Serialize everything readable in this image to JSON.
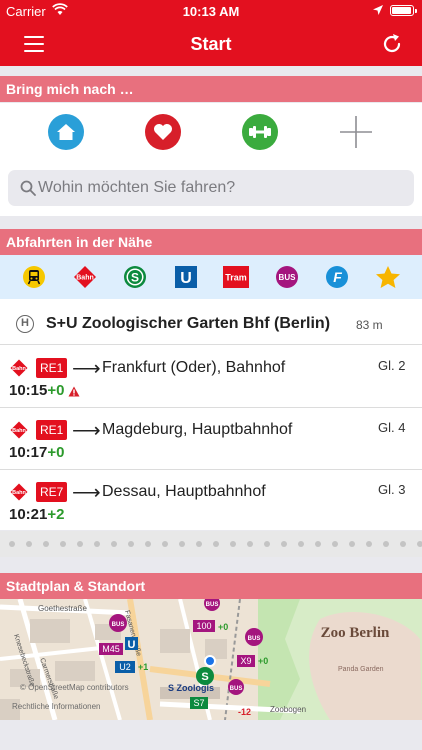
{
  "status_bar": {
    "carrier": "Carrier",
    "time": "10:13 AM",
    "battery_level": 0.95
  },
  "nav": {
    "title": "Start"
  },
  "bring": {
    "header": "Bring mich nach …",
    "shortcuts": [
      {
        "icon": "home-icon",
        "color": "#2a9fd8"
      },
      {
        "icon": "heart-icon",
        "color": "#d71f2a"
      },
      {
        "icon": "dumbbell-icon",
        "color": "#3bab3e"
      },
      {
        "icon": "plus-icon",
        "color": "#8e8e93"
      }
    ]
  },
  "search": {
    "placeholder": "Wohin möchten Sie fahren?"
  },
  "nearby": {
    "header": "Abfahrten in der Nähe",
    "filters": [
      "regional-train-icon",
      "bahn-icon",
      "s-bahn-icon",
      "u-bahn-icon",
      "tram-icon",
      "bus-icon",
      "ferry-icon",
      "star-icon"
    ],
    "filter_labels": {
      "bahn": "Bahn",
      "s": "S",
      "u": "U",
      "tram": "Tram",
      "bus": "BUS",
      "ferry": "F"
    }
  },
  "station": {
    "badge": "H",
    "name": "S+U Zoologischer Garten Bhf (Berlin)",
    "distance": "83 m"
  },
  "departures": [
    {
      "line": "RE1",
      "destination": "Frankfurt (Oder), Bahnhof",
      "track": "Gl. 2",
      "time": "10:15",
      "delay": "+0",
      "warning": true
    },
    {
      "line": "RE1",
      "destination": "Magdeburg, Hauptbahnhof",
      "track": "Gl. 4",
      "time": "10:17",
      "delay": "+0",
      "warning": false
    },
    {
      "line": "RE7",
      "destination": "Dessau, Hauptbahnhof",
      "track": "Gl. 3",
      "time": "10:21",
      "delay": "+2",
      "warning": false
    }
  ],
  "departure_arrow": "⟶",
  "bahn_logo_text": "Bahn",
  "map": {
    "header": "Stadtplan & Standort",
    "attribution": "© OpenStreetMap contributors",
    "legal": "Rechtliche Informationen",
    "zoo_label": "Zoo Berlin",
    "streets": [
      "Goethestraße",
      "Carmerstraße",
      "Knesebeckstraße",
      "Fasanenstraße",
      "Zoobogen"
    ],
    "places": [
      "Panda Garden"
    ],
    "badges": [
      "BUS",
      "100",
      "+0",
      "M45",
      "U",
      "U2",
      "+1",
      "S",
      "S Zoologis",
      "X9",
      "+0",
      "S7",
      "-12",
      "BUS"
    ]
  }
}
